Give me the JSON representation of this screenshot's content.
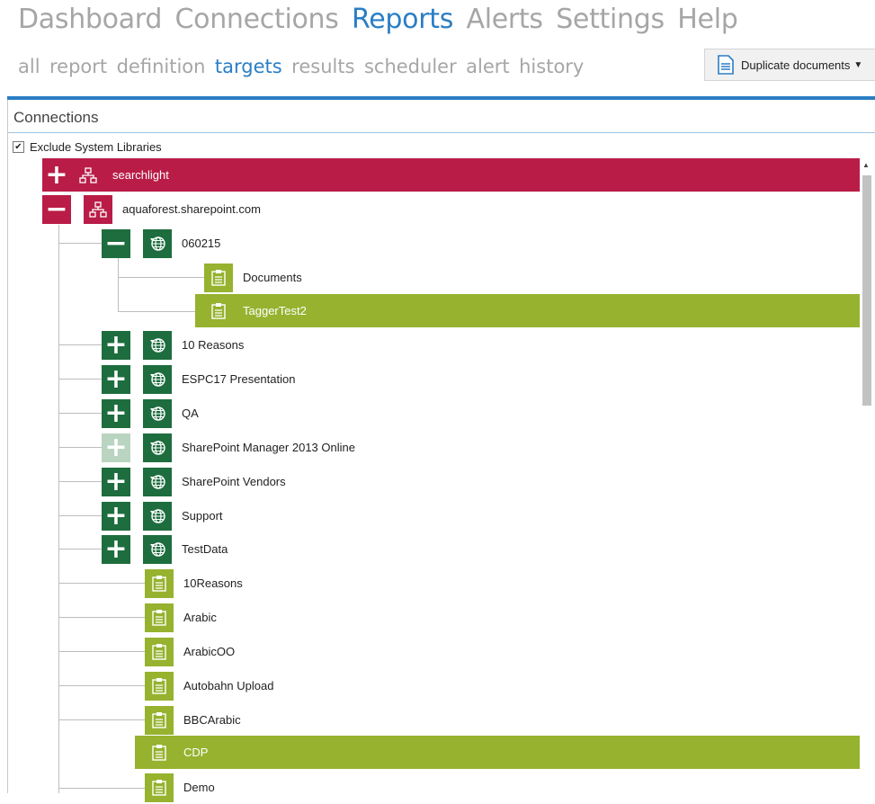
{
  "nav": {
    "main": [
      "Dashboard",
      "Connections",
      "Reports",
      "Alerts",
      "Settings",
      "Help"
    ],
    "main_active": "Reports",
    "sub": [
      "all",
      "report",
      "definition",
      "targets",
      "results",
      "scheduler",
      "alert",
      "history"
    ],
    "sub_active": "targets"
  },
  "toolbar": {
    "duplicate_label": "Duplicate documents"
  },
  "panel": {
    "title": "Connections",
    "exclude_label": "Exclude System Libraries",
    "exclude_checked": true
  },
  "tree": {
    "searchlight": "searchlight",
    "aquaforest": "aquaforest.sharepoint.com",
    "site_060215": "060215",
    "documents": "Documents",
    "taggertest2": "TaggerTest2",
    "sites": [
      "10 Reasons",
      "ESPC17 Presentation",
      "QA",
      "SharePoint Manager 2013 Online",
      "SharePoint Vendors",
      "Support",
      "TestData"
    ],
    "libraries": [
      "10Reasons",
      "Arabic",
      "ArabicOO",
      "Autobahn Upload",
      "BBCArabic",
      "CDP",
      "Demo"
    ]
  },
  "colors": {
    "accent": "#2a7ec5",
    "connection": "#b91c47",
    "site": "#1e6d3e",
    "library": "#96b22f"
  }
}
